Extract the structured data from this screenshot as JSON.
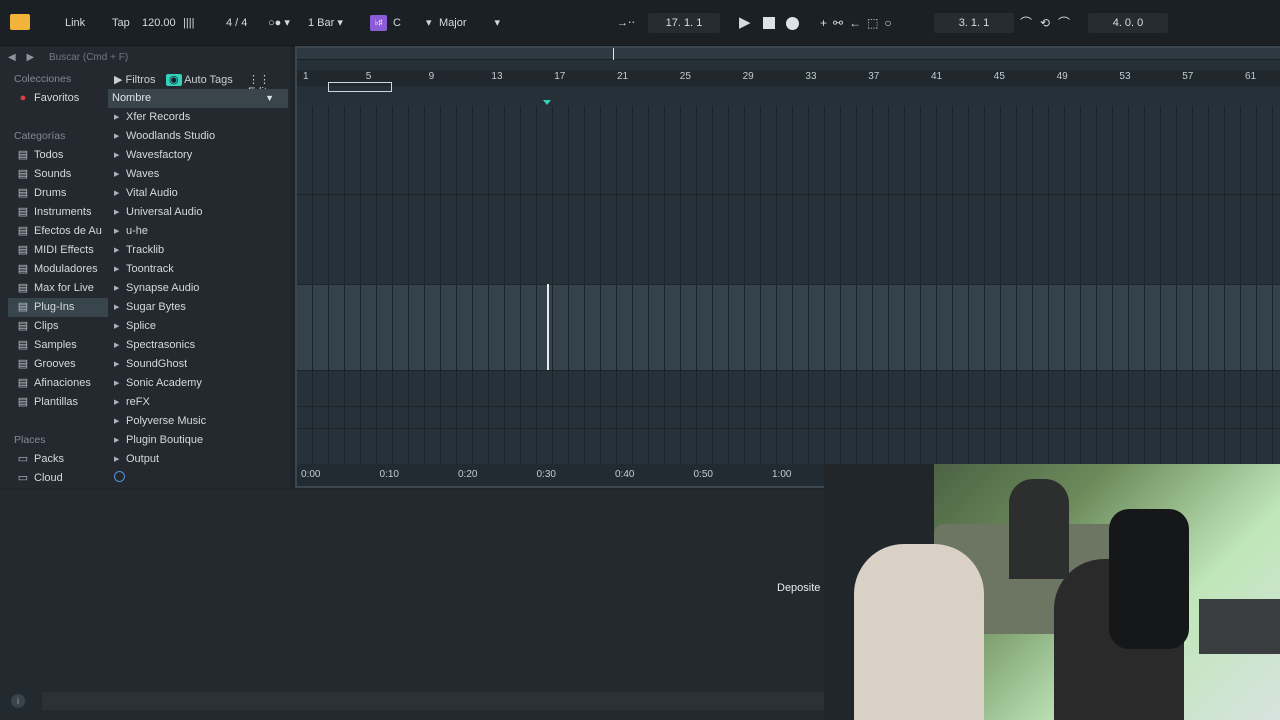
{
  "topbar": {
    "link": "Link",
    "tap": "Tap",
    "tempo": "120.00",
    "signature": "4 / 4",
    "quantize": "1 Bar",
    "key_root": "C",
    "scale": "Major",
    "position": "17.   1.   1",
    "loop_start": "3.   1.   1",
    "loop_length": "4.   0.   0"
  },
  "browser": {
    "search_placeholder": "Buscar (Cmd + F)",
    "collections_header": "Colecciones",
    "favorites": "Favoritos",
    "categories_header": "Categorías",
    "categories": [
      {
        "label": "Todos",
        "icon": "list-icon"
      },
      {
        "label": "Sounds",
        "icon": "note-icon"
      },
      {
        "label": "Drums",
        "icon": "grid-icon"
      },
      {
        "label": "Instruments",
        "icon": "clock-icon"
      },
      {
        "label": "Efectos de Au",
        "icon": "waveform-icon"
      },
      {
        "label": "MIDI Effects",
        "icon": "midi-icon"
      },
      {
        "label": "Moduladores",
        "icon": "modulator-icon"
      },
      {
        "label": "Max for Live",
        "icon": "max-icon"
      },
      {
        "label": "Plug-Ins",
        "icon": "plugin-icon"
      },
      {
        "label": "Clips",
        "icon": "clip-icon"
      },
      {
        "label": "Samples",
        "icon": "sample-icon"
      },
      {
        "label": "Grooves",
        "icon": "groove-icon"
      },
      {
        "label": "Afinaciones",
        "icon": "tuning-icon"
      },
      {
        "label": "Plantillas",
        "icon": "template-icon"
      }
    ],
    "places_header": "Places",
    "places": [
      {
        "label": "Packs",
        "icon": "packs-icon"
      },
      {
        "label": "Cloud",
        "icon": "cloud-icon"
      }
    ],
    "filters_label": "Filtros",
    "autotags_label": "Auto Tags",
    "edit_label": "Edit",
    "column_header": "Nombre",
    "vendors": [
      "Xfer Records",
      "Woodlands Studio",
      "Wavesfactory",
      "Waves",
      "Vital Audio",
      "Universal Audio",
      "u-he",
      "Tracklib",
      "Toontrack",
      "Synapse Audio",
      "Sugar Bytes",
      "Splice",
      "Spectrasonics",
      "SoundGhost",
      "Sonic Academy",
      "reFX",
      "Polyverse Music",
      "Plugin Boutique",
      "Output"
    ]
  },
  "arrangement": {
    "bars": [
      "1",
      "5",
      "9",
      "13",
      "17",
      "21",
      "25",
      "29",
      "33",
      "37",
      "41",
      "45",
      "49",
      "53",
      "57",
      "61"
    ],
    "times": [
      "0:00",
      "0:10",
      "0:20",
      "0:30",
      "0:40",
      "0:50",
      "1:00"
    ]
  },
  "bottom": {
    "overlay_text": "Deposite a"
  },
  "colors": {
    "accent": "#36d0b8",
    "selected": "#39454d",
    "scale_badge": "#8c5cd8"
  }
}
